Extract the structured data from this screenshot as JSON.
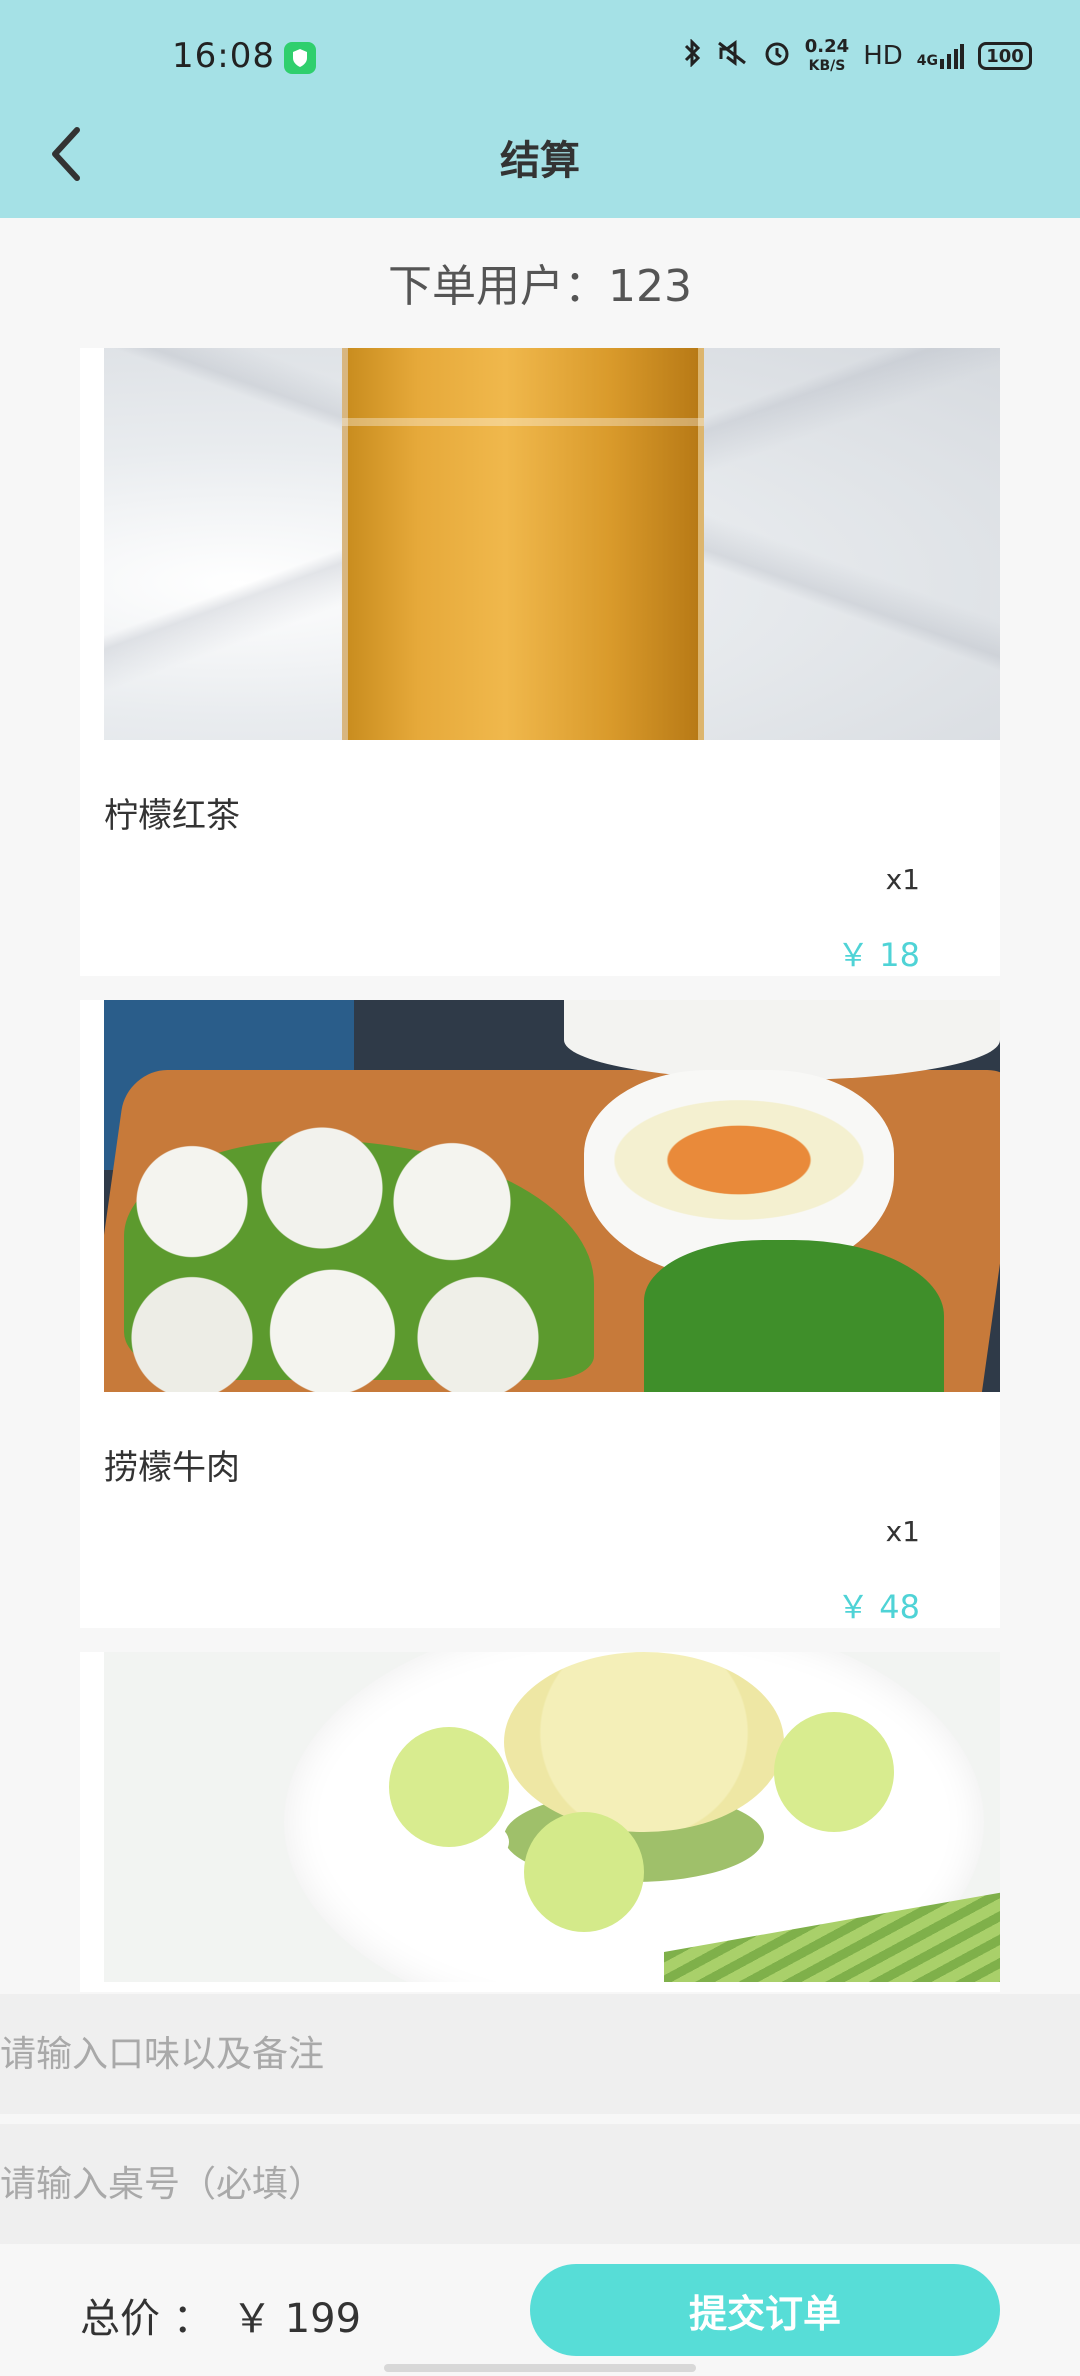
{
  "status_bar": {
    "time": "16:08",
    "net_speed_top": "0.24",
    "net_speed_unit": "KB/S",
    "hd": "HD",
    "network": "4G",
    "battery": "100"
  },
  "header": {
    "title": "结算",
    "back_icon": "chevron-left-icon"
  },
  "order_user": "下单用户：123",
  "items": [
    {
      "name": "柠檬红茶",
      "qty": "x1",
      "price": "￥ 18"
    },
    {
      "name": "捞檬牛肉",
      "qty": "x1",
      "price": "￥ 48"
    },
    {
      "name": "",
      "qty": "",
      "price": ""
    }
  ],
  "inputs": {
    "remark_placeholder": "请输入口味以及备注",
    "table_placeholder": "请输入桌号（必填）"
  },
  "footer": {
    "total_label": "总价 ：",
    "total_value": "￥ 199",
    "submit_label": "提交订单"
  },
  "colors": {
    "header_bg": "#a5e1e6",
    "accent": "#57ddd7",
    "price": "#4fd3d6"
  }
}
